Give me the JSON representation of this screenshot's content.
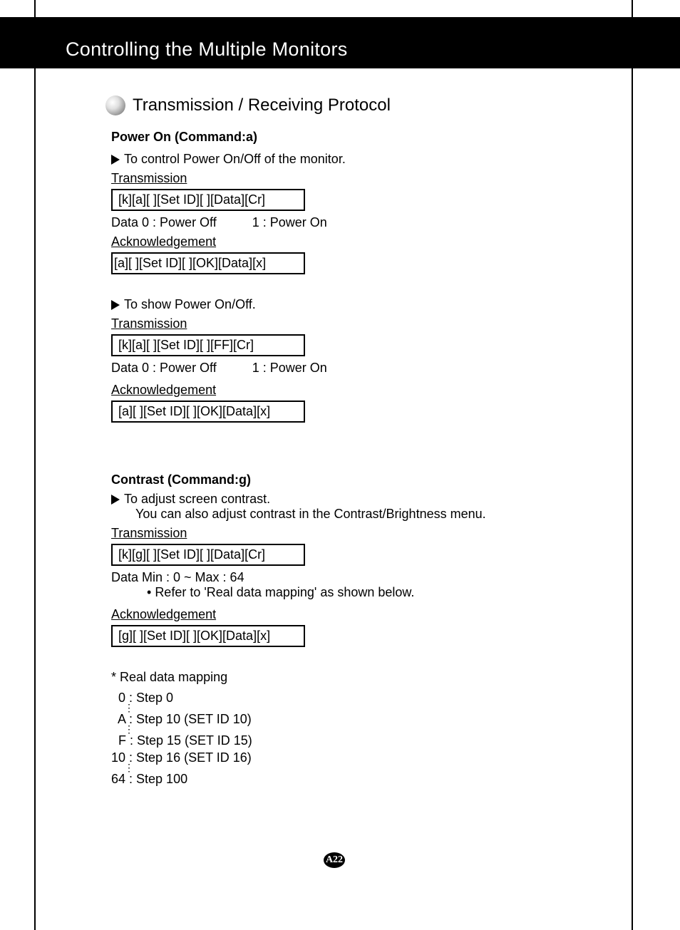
{
  "header": {
    "title": "Controlling the Multiple Monitors"
  },
  "section": {
    "title": "Transmission / Receiving Protocol"
  },
  "power": {
    "heading": "Power On (Command:a)",
    "desc1": "To control Power On/Off of the monitor.",
    "tx_label": "Transmission",
    "tx_box1": "[k][a][ ][Set ID][ ][Data][Cr]",
    "data_line": "Data 0 : Power Off          1 : Power On",
    "ack_label": "Acknowledgement",
    "ack_box1": "[a][ ][Set ID][ ][OK][Data][x]",
    "desc2": "To show Power On/Off.",
    "tx_box2": "[k][a][ ][Set ID][ ][FF][Cr]",
    "data_line2": "Data 0 : Power Off          1 : Power On",
    "ack_box2": "[a][ ][Set ID][ ][OK][Data][x]"
  },
  "contrast": {
    "heading": "Contrast (Command:g)",
    "desc1": "To adjust screen contrast.",
    "desc2": "You can also adjust contrast in the Contrast/Brightness menu.",
    "tx_label": "Transmission",
    "tx_box": "[k][g][ ][Set ID][ ][Data][Cr]",
    "data_line": "Data Min : 0 ~ Max : 64",
    "refer": "Refer to 'Real data mapping' as shown below.",
    "ack_label": "Acknowledgement",
    "ack_box": "[g][ ][Set ID][ ][OK][Data][x]"
  },
  "mapping": {
    "title": "* Real data mapping",
    "l1": "  0 : Step 0",
    "l2": "  A : Step 10 (SET ID 10)",
    "l3": "  F : Step 15 (SET ID 15)",
    "l4": "10 : Step 16 (SET ID 16)",
    "l5": "64 : Step 100"
  },
  "page": "A22"
}
